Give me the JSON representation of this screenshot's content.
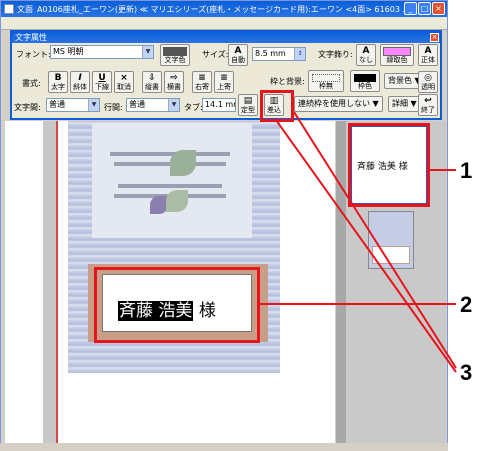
{
  "window": {
    "title": "A0106座札_エーワン(更新) ≪ マリエシリーズ(座札・メッセージカード用):エーワン <4面> 61603 ...",
    "app_label": "文面",
    "buttons": {
      "minimize": "_",
      "maximize": "□",
      "close": "×"
    }
  },
  "dialog": {
    "title": "文字属性",
    "close": "×",
    "font_label": "フォント:",
    "font_value": "MS 明朝",
    "font_color_label": "文字色",
    "size_label": "サイズ:",
    "size_auto_label": "自動",
    "size_value": "8.5 mm",
    "decoration_label": "文字飾り:",
    "decoration_none": "なし",
    "decoration_outline_color": "縁取色",
    "upright_label": "正体",
    "style_label": "書式:",
    "bold_glyph": "B",
    "bold_label": "太字",
    "italic_glyph": "I",
    "italic_label": "斜体",
    "underline_glyph": "U",
    "underline_label": "下線",
    "cancel_glyph": "×",
    "cancel_label": "取消",
    "vertical_label": "縦書",
    "horizontal_label": "横書",
    "align_right_label": "右寄",
    "align_top_label": "上寄",
    "fixed_label": "定型",
    "difference_label": "差込",
    "frame_bg_label": "枠と背景:",
    "frame_none_label": "枠無",
    "frame_color_label": "枠色",
    "bg_color_label": "背景色",
    "transparent_label": "透明",
    "char_spacing_label": "文字間:",
    "char_spacing_value": "普通",
    "line_spacing_label": "行間:",
    "line_spacing_value": "普通",
    "tab_label": "タブ:",
    "tab_value": "14.1 mm",
    "consecutive_frame_value": "連続枠を使用しない",
    "detail_label": "詳細",
    "end_label": "終了"
  },
  "canvas": {
    "name_text_selected": "斉藤 浩美",
    "name_text_suffix": "様"
  },
  "thumbnails": [
    {
      "text": "斉藤 浩美 様"
    }
  ],
  "callouts": [
    {
      "number": "1"
    },
    {
      "number": "2"
    },
    {
      "number": "3"
    }
  ],
  "colors": {
    "highlight": "#e8141c",
    "font_color": "#555555",
    "outline_color": "#ff88ff",
    "bg_swatch": "#000000"
  }
}
